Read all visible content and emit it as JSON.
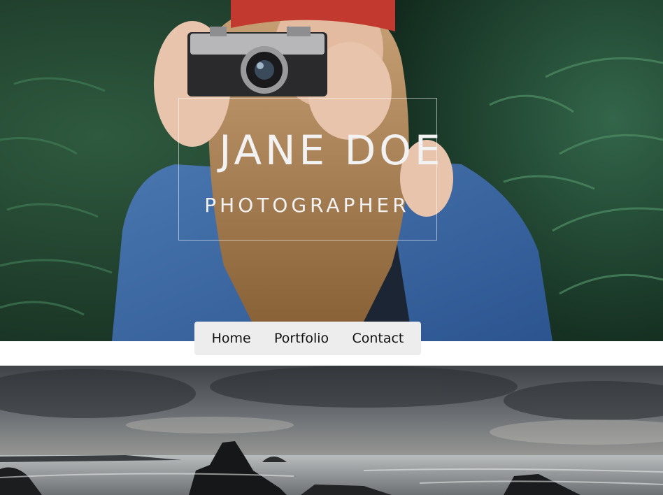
{
  "hero": {
    "title": "JANE DOE",
    "subtitle": "PHOTOGRAPHER"
  },
  "nav": {
    "items": [
      {
        "label": "Home"
      },
      {
        "label": "Portfolio"
      },
      {
        "label": "Contact"
      }
    ]
  },
  "colors": {
    "nav_background": "#ededed",
    "title_text": "#f2f2f2",
    "page_background": "#ffffff"
  }
}
